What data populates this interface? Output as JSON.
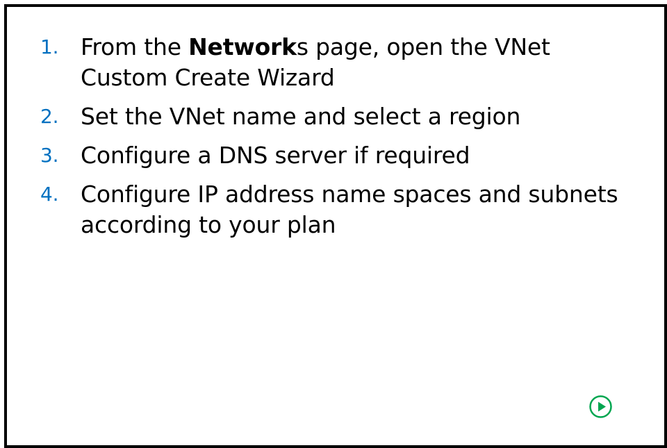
{
  "colors": {
    "step_number": "#0070c0",
    "play_button": "#00a650",
    "frame_border": "#000000"
  },
  "steps": [
    {
      "number": "1.",
      "text_before": "From the ",
      "text_bold": "Network",
      "text_after": "s page, open the VNet Custom Create Wizard"
    },
    {
      "number": "2.",
      "text": "Set the VNet name and select a region"
    },
    {
      "number": "3.",
      "text": "Configure a DNS server if required"
    },
    {
      "number": "4.",
      "text": "Configure IP address name spaces and subnets according to your plan"
    }
  ],
  "play_button": {
    "icon": "play-circle-icon"
  }
}
